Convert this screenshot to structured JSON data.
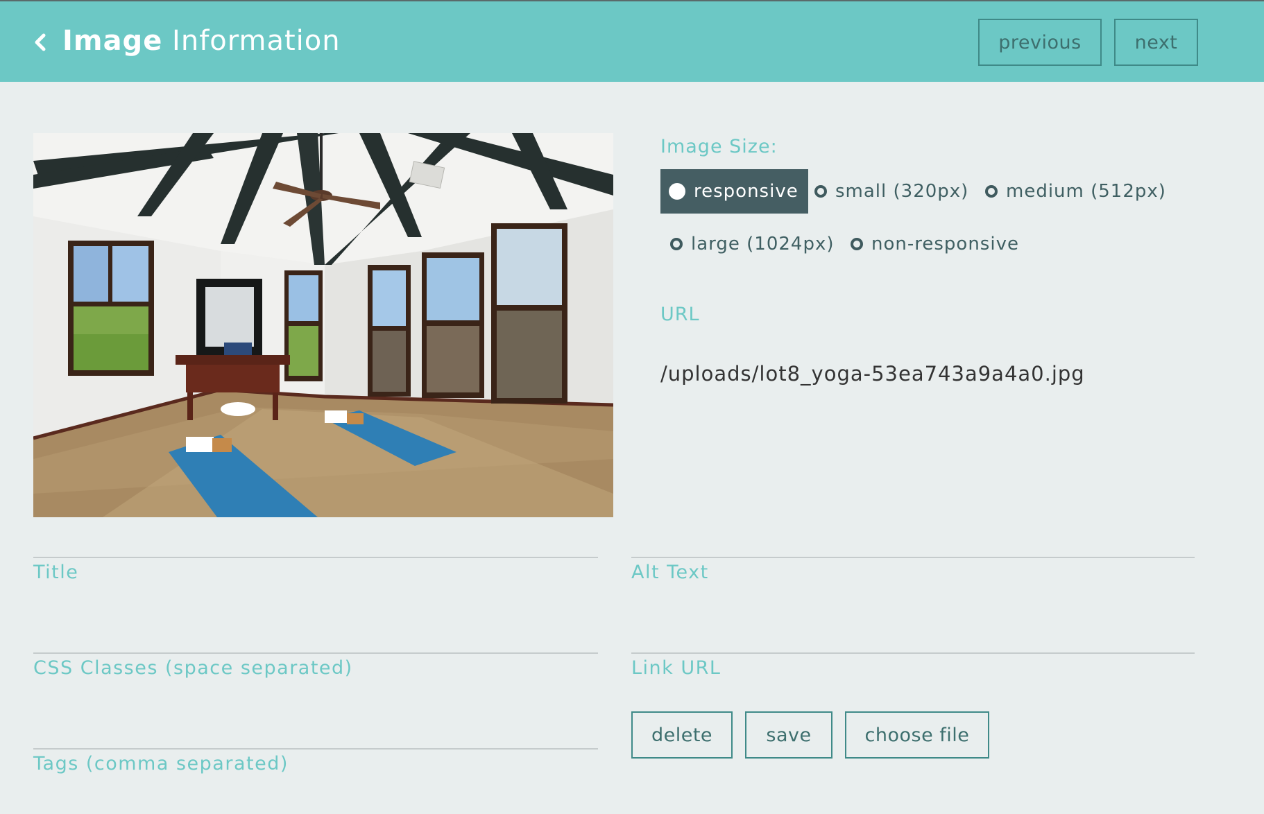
{
  "header": {
    "title_bold": "Image",
    "title_rest": " Information",
    "back_icon": "chevron-left-icon",
    "previous_label": "previous",
    "next_label": "next"
  },
  "image_size": {
    "label": "Image Size:",
    "options": [
      {
        "label": "responsive",
        "selected": true
      },
      {
        "label": "small (320px)",
        "selected": false
      },
      {
        "label": "medium (512px)",
        "selected": false
      },
      {
        "label": "large (1024px)",
        "selected": false
      },
      {
        "label": "non-responsive",
        "selected": false
      }
    ]
  },
  "url": {
    "label": "URL",
    "value": "/uploads/lot8_yoga-53ea743a9a4a0.jpg"
  },
  "fields": {
    "title_label": "Title",
    "alt_text_label": "Alt Text",
    "css_classes_label": "CSS Classes (space separated)",
    "link_url_label": "Link URL",
    "tags_label": "Tags (comma separated)"
  },
  "actions": {
    "delete_label": "delete",
    "save_label": "save",
    "choose_file_label": "choose file"
  },
  "colors": {
    "header_bg": "#6cc8c5",
    "accent": "#6cc8c5",
    "selected_option_bg": "#455e63",
    "page_bg": "#e9eeee"
  }
}
